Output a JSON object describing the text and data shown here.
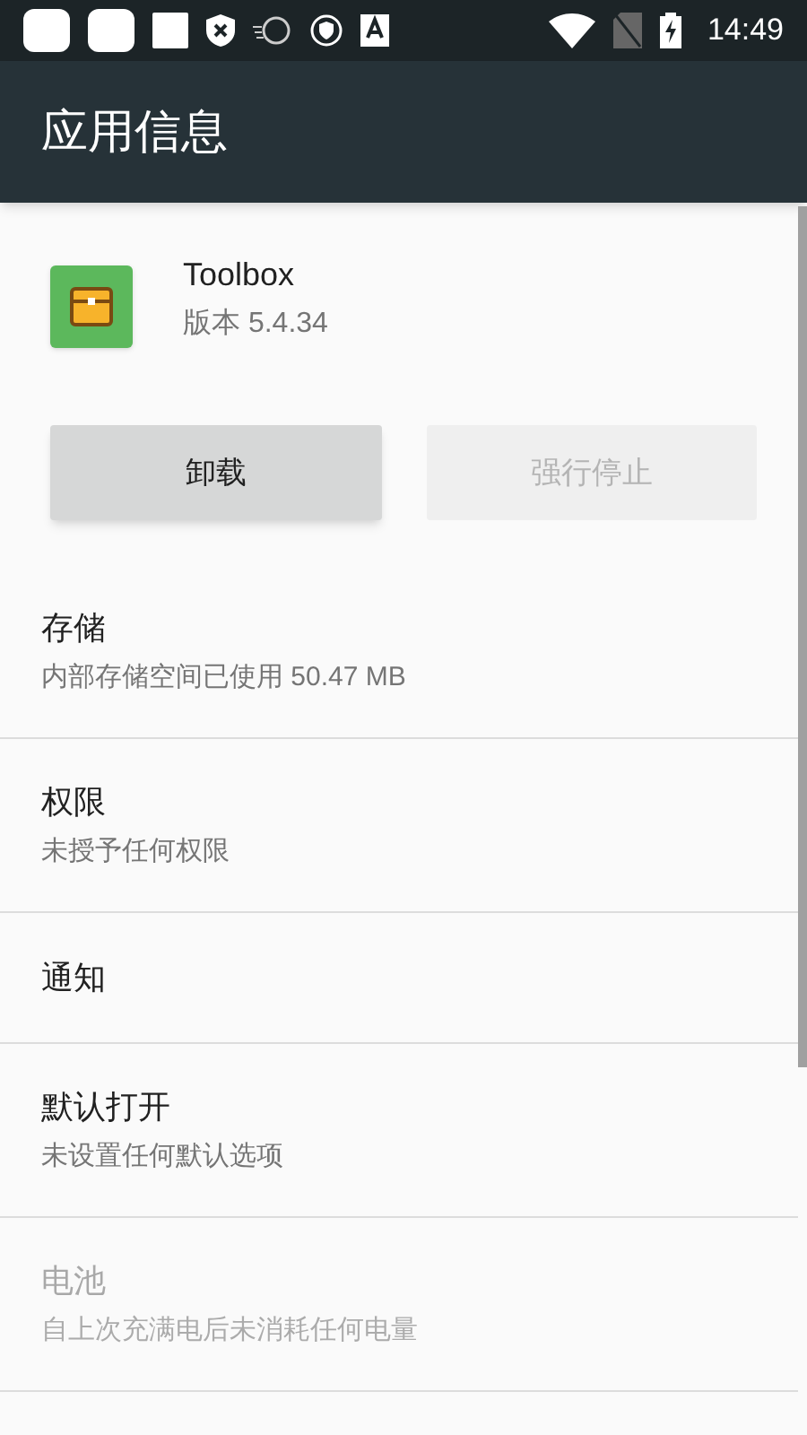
{
  "status_bar": {
    "time": "14:49"
  },
  "toolbar": {
    "title": "应用信息"
  },
  "app": {
    "name": "Toolbox",
    "version": "版本 5.4.34"
  },
  "buttons": [
    {
      "label": "卸载",
      "disabled": false
    },
    {
      "label": "强行停止",
      "disabled": true
    }
  ],
  "items": [
    {
      "title": "存储",
      "subtitle": "内部存储空间已使用 50.47 MB",
      "disabled": false
    },
    {
      "title": "权限",
      "subtitle": "未授予任何权限",
      "disabled": false
    },
    {
      "title": "通知",
      "disabled": false
    },
    {
      "title": "默认打开",
      "subtitle": "未设置任何默认选项",
      "disabled": false
    },
    {
      "title": "电池",
      "subtitle": "自上次充满电后未消耗任何电量",
      "disabled": true
    }
  ]
}
